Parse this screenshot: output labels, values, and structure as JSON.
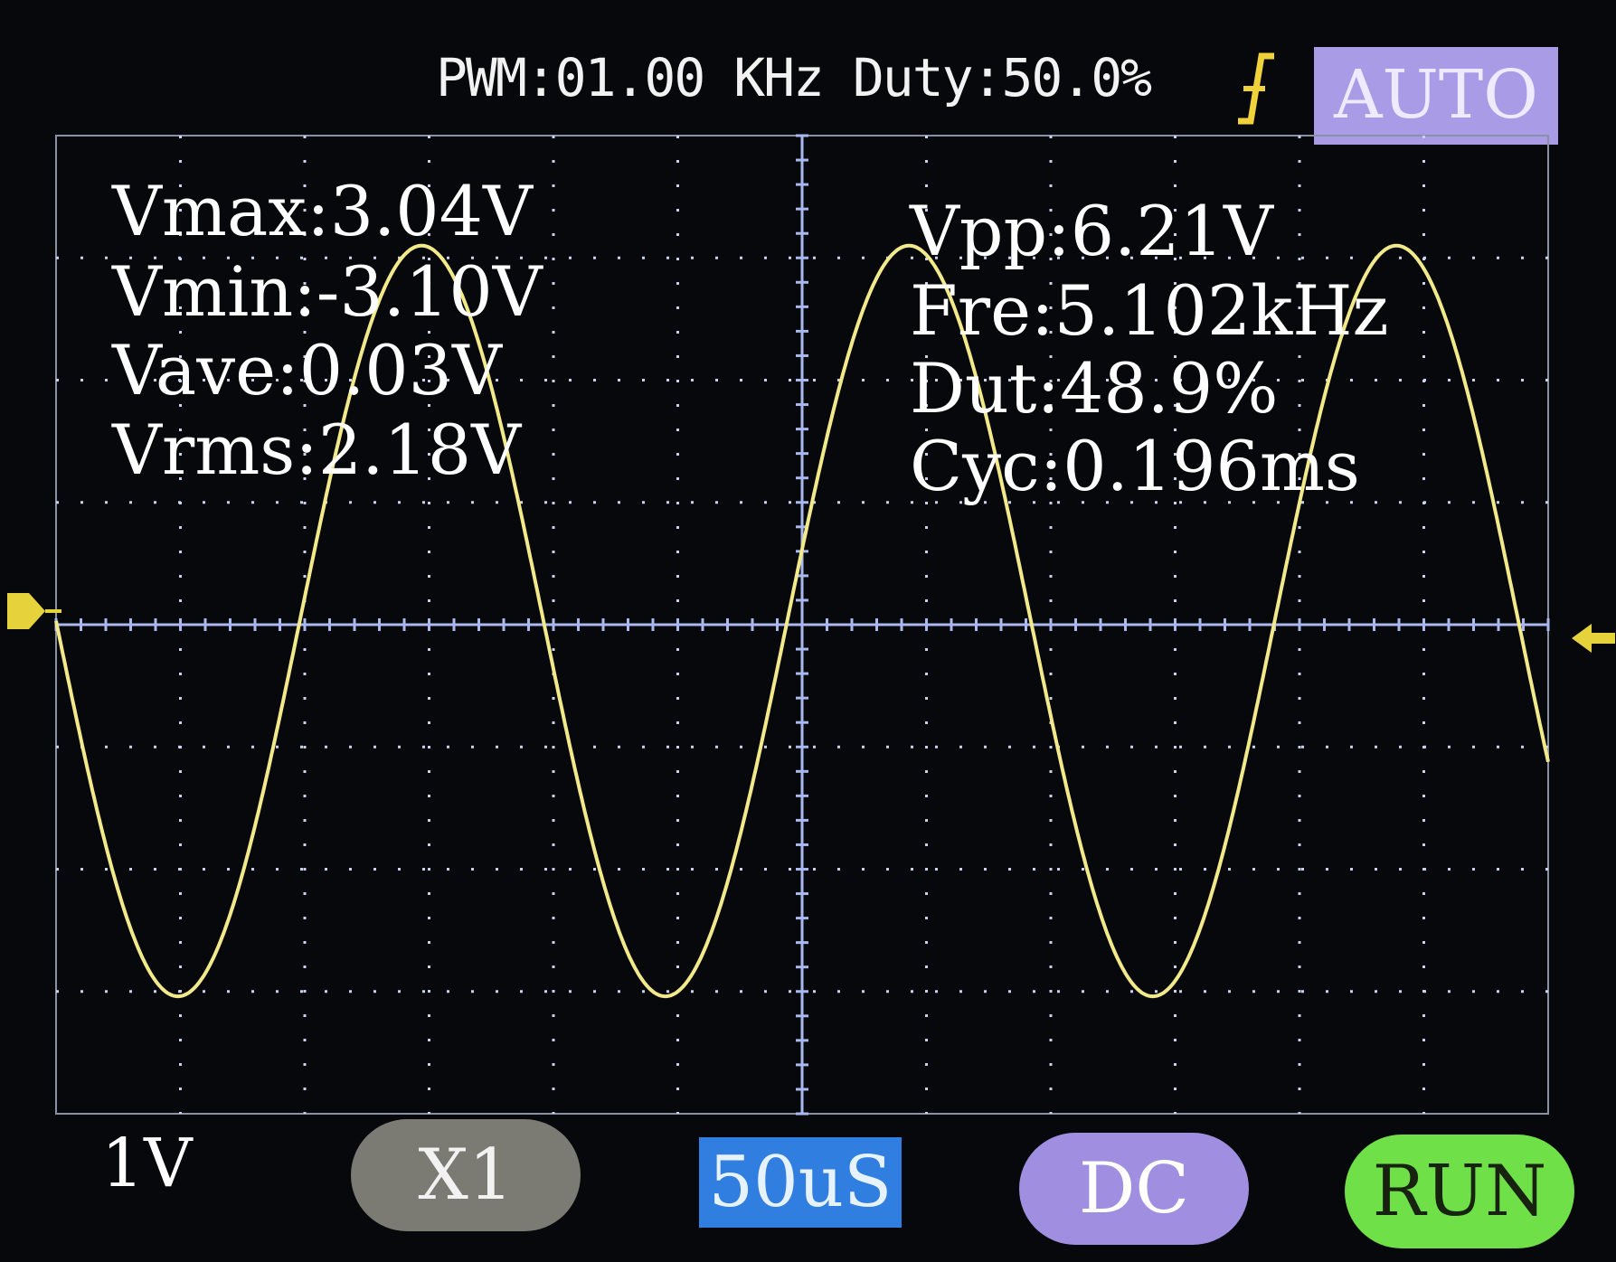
{
  "header": {
    "pwm_text": "PWM:01.00 KHz Duty:50.0%",
    "trigger_edge_icon": "rising-edge-trigger-icon",
    "mode_badge": "AUTO"
  },
  "measurements_left": {
    "vmax": "Vmax:3.04V",
    "vmin": "Vmin:-3.10V",
    "vave": "Vave:0.03V",
    "vrms": "Vrms:2.18V"
  },
  "measurements_right": {
    "vpp": "Vpp:6.21V",
    "fre": "Fre:5.102kHz",
    "dut": "Dut:48.9%",
    "cyc": "Cyc:0.196ms"
  },
  "bottom_bar": {
    "volts_per_div": "1V",
    "probe": "X1",
    "timebase": "50uS",
    "coupling": "DC",
    "run_state": "RUN"
  },
  "colors": {
    "trace": "#f2e98a",
    "grid": "#c8d2ee",
    "axis": "#a9b8ee",
    "auto_badge": "#a99be6",
    "timebase_bg": "#2f7ee0",
    "coupling_bg": "#a08fe0",
    "run_bg": "#6fe048",
    "probe_bg": "#7b7b74"
  },
  "chart_data": {
    "type": "line",
    "title": "",
    "xlabel": "",
    "ylabel": "",
    "x_divisions": 12,
    "y_divisions": 8,
    "time_per_div_us": 50,
    "volts_per_div": 1,
    "xlim_us": [
      0,
      600
    ],
    "ylim_v": [
      -4,
      4
    ],
    "grid": true,
    "series": [
      {
        "frequency_khz": 5.102,
        "amplitude_v": 3.07,
        "offset_v": 0.03,
        "phase_start": "falling zero-crossing at left edge"
      }
    ]
  }
}
